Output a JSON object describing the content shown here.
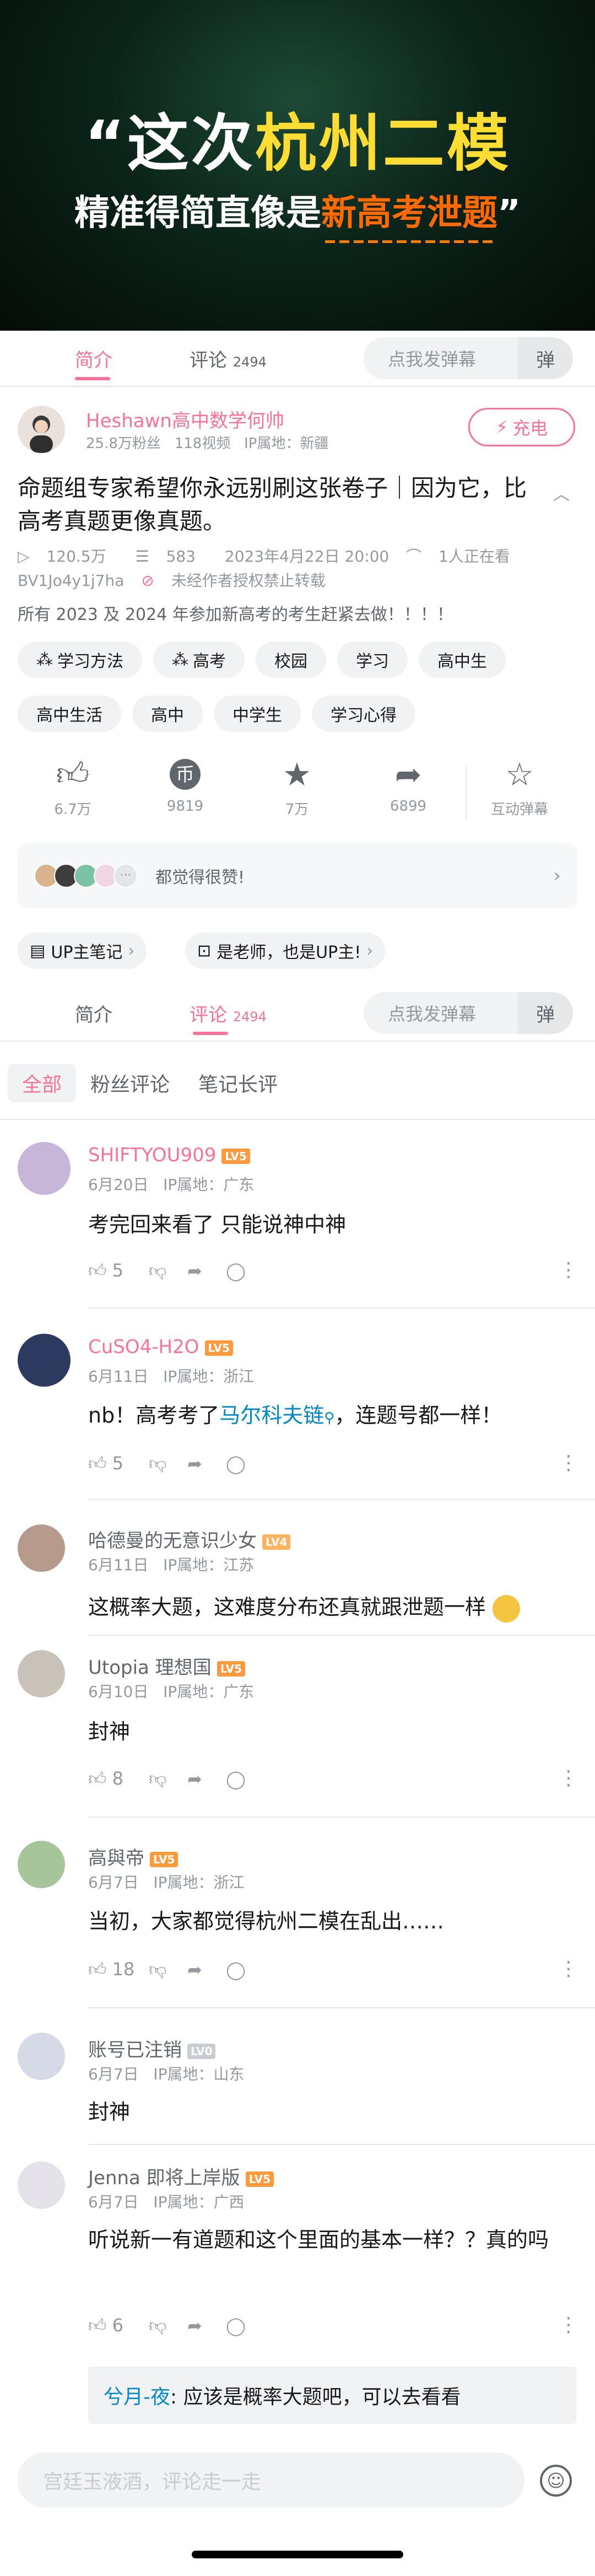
{
  "video": {
    "title_prefix": "“这次",
    "title_highlight": "杭州二模",
    "subtitle_prefix": "精准得简直像是",
    "subtitle_highlight": "新高考泄题",
    "subtitle_suffix": "”"
  },
  "tabs": {
    "intro": "简介",
    "comments": "评论",
    "comment_count": "2494",
    "danmu_placeholder": "点我发弹幕",
    "danmu_btn": "弹"
  },
  "author": {
    "name": "Heshawn高中数学何帅",
    "fans": "25.8万粉丝",
    "videos": "118视频",
    "ip": "IP属地：新疆",
    "charge": "充电"
  },
  "video_info": {
    "title": "命题组专家希望你永远别刷这张卷子｜因为它，比高考真题更像真题。",
    "views": "120.5万",
    "danmaku": "583",
    "date": "2023年4月22日  20:00",
    "watching": "1人正在看",
    "bvid": "BV1Jo4y1j7ha",
    "copyright": "未经作者授权禁止转载",
    "desc": "所有 2023 及 2024 年参加新高考的考生赶紧去做！！！！"
  },
  "tags": [
    "学习方法",
    "高考",
    "校园",
    "学习",
    "高中生",
    "高中生活",
    "高中",
    "中学生",
    "学习心得"
  ],
  "actions": {
    "like": "6.7万",
    "coin": "9819",
    "fav": "7万",
    "share": "6899",
    "interactive": "互动弹幕"
  },
  "likes_card": {
    "text": "都觉得很赞!"
  },
  "pills": {
    "note": "UP主笔记",
    "teacher": "是老师，也是UP主!"
  },
  "sort": {
    "all": "全部",
    "fans": "粉丝评论",
    "notes": "笔记长评"
  },
  "comments": [
    {
      "name": "SHIFTYOU909",
      "level": "LV5",
      "date": "6月20日",
      "ip": "IP属地：广东",
      "text": "考完回来看了 只能说神中神",
      "likes": "5"
    },
    {
      "name": "CuSO4-H2O",
      "level": "LV5",
      "date": "6月11日",
      "ip": "IP属地：浙江",
      "text_a": "nb！高考考了",
      "link": "马尔科夫链",
      "text_b": "，连题号都一样！",
      "likes": "5"
    },
    {
      "name": "哈德曼的无意识少女",
      "level": "LV4",
      "date": "6月11日",
      "ip": "IP属地：江苏",
      "text": "这概率大题，这难度分布还真就跟泄题一样",
      "likes": ""
    },
    {
      "name": "Utopia 理想国",
      "level": "LV5",
      "date": "6月10日",
      "ip": "IP属地：广东",
      "text": "封神",
      "likes": "8"
    },
    {
      "name": "高與帝",
      "level": "LV5",
      "date": "6月7日",
      "ip": "IP属地：浙江",
      "text": "当初，大家都觉得杭州二模在乱出……",
      "likes": "18"
    },
    {
      "name": "账号已注销",
      "level": "LV0",
      "date": "6月7日",
      "ip": "IP属地：山东",
      "text": "封神",
      "likes": ""
    },
    {
      "name": "Jenna 即将上岸版",
      "level": "LV5",
      "date": "6月7日",
      "ip": "IP属地：广西",
      "text": "听说新一有道题和这个里面的基本一样？？真的吗",
      "likes": "6"
    }
  ],
  "reply": {
    "name": "兮月-夜",
    "text": ": 应该是概率大题吧，可以去看看"
  },
  "input": {
    "placeholder": "宫廷玉液酒，评论走一走"
  }
}
